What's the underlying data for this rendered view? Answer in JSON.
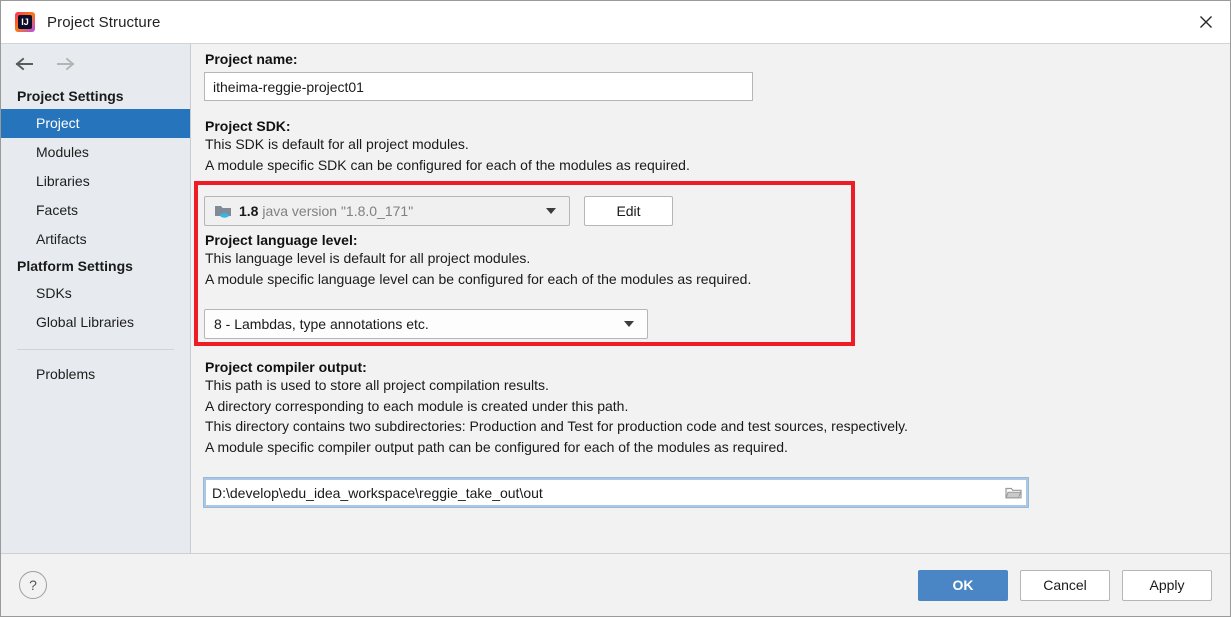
{
  "window": {
    "title": "Project Structure",
    "app_icon": "intellij-idea-logo",
    "close_icon": "close-icon"
  },
  "sidebar": {
    "back_icon": "arrow-left-icon",
    "forward_icon": "arrow-right-icon",
    "groups": [
      {
        "title": "Project Settings",
        "items": [
          {
            "label": "Project",
            "selected": true
          },
          {
            "label": "Modules",
            "selected": false
          },
          {
            "label": "Libraries",
            "selected": false
          },
          {
            "label": "Facets",
            "selected": false
          },
          {
            "label": "Artifacts",
            "selected": false
          }
        ]
      },
      {
        "title": "Platform Settings",
        "items": [
          {
            "label": "SDKs",
            "selected": false
          },
          {
            "label": "Global Libraries",
            "selected": false
          }
        ]
      }
    ],
    "extra_items": [
      {
        "label": "Problems",
        "selected": false
      }
    ]
  },
  "main": {
    "project_name": {
      "label": "Project name:",
      "value": "itheima-reggie-project01"
    },
    "project_sdk": {
      "label": "Project SDK:",
      "desc1": "This SDK is default for all project modules.",
      "desc2": "A module specific SDK can be configured for each of the modules as required.",
      "sdk_icon": "jdk-folder-icon",
      "version": "1.8",
      "version_detail": "java version \"1.8.0_171\"",
      "dropdown_icon": "chevron-down-icon",
      "edit_label": "Edit"
    },
    "language_level": {
      "label": "Project language level:",
      "desc1": "This language level is default for all project modules.",
      "desc2": "A module specific language level can be configured for each of the modules as required.",
      "value": "8 - Lambdas, type annotations etc.",
      "dropdown_icon": "chevron-down-icon"
    },
    "compiler_output": {
      "label": "Project compiler output:",
      "desc1": "This path is used to store all project compilation results.",
      "desc2": "A directory corresponding to each module is created under this path.",
      "desc3": "This directory contains two subdirectories: Production and Test for production code and test sources, respectively.",
      "desc4": "A module specific compiler output path can be configured for each of the modules as required.",
      "value": "D:\\develop\\edu_idea_workspace\\reggie_take_out\\out",
      "browse_icon": "folder-icon"
    },
    "annotation": {
      "color": "#ee1c25",
      "name": "red-highlight-box"
    }
  },
  "footer": {
    "help_label": "?",
    "ok_label": "OK",
    "cancel_label": "Cancel",
    "apply_label": "Apply",
    "ok_color": "#4a86c5"
  }
}
